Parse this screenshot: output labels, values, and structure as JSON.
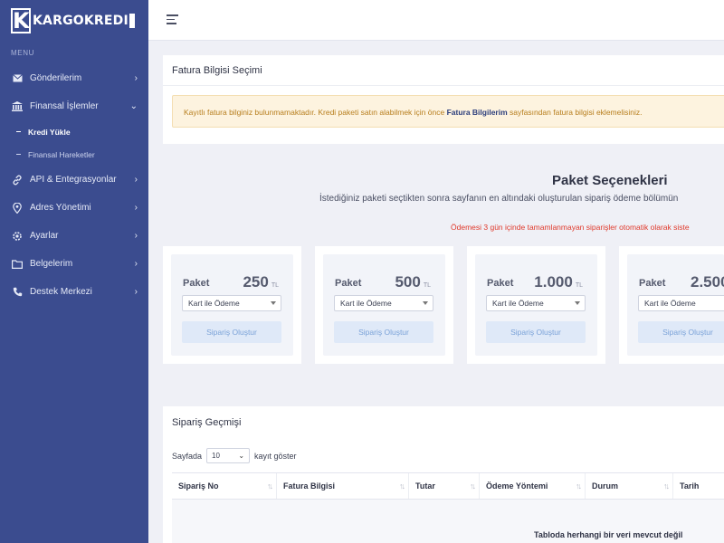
{
  "brand": {
    "name": "KARGOKREDI",
    "logo_letter": "K"
  },
  "sidebar": {
    "menu_heading": "MENU",
    "items": [
      {
        "label": "Gönderilerim",
        "icon": "envelope-icon",
        "expanded": false
      },
      {
        "label": "Finansal İşlemler",
        "icon": "bank-icon",
        "expanded": true,
        "children": [
          {
            "label": "Kredi Yükle",
            "active": true
          },
          {
            "label": "Finansal Hareketler",
            "active": false
          }
        ]
      },
      {
        "label": "API & Entegrasyonlar",
        "icon": "link-icon",
        "expanded": false
      },
      {
        "label": "Adres Yönetimi",
        "icon": "location-pin-icon",
        "expanded": false
      },
      {
        "label": "Ayarlar",
        "icon": "gear-icon",
        "expanded": false
      },
      {
        "label": "Belgelerim",
        "icon": "folder-icon",
        "expanded": false
      },
      {
        "label": "Destek Merkezi",
        "icon": "phone-icon",
        "expanded": false
      }
    ]
  },
  "fatura": {
    "title": "Fatura Bilgisi Seçimi",
    "alert_pre": "Kayıtlı fatura bilginiz bulunmamaktadır. Kredi paketi satın alabilmek için önce",
    "alert_link": "Fatura Bilgilerim",
    "alert_post": "sayfasından fatura bilgisi eklemelisiniz."
  },
  "paket": {
    "title": "Paket Seçenekleri",
    "subtitle": "İstediğiniz paketi seçtikten sonra sayfanın en altındaki oluşturulan sipariş ödeme bölümün",
    "warning": "Ödemesi 3 gün içinde tamamlanmayan siparişler otomatik olarak siste",
    "packages": [
      {
        "name": "Paket",
        "price": "250",
        "currency": "TL",
        "payment": "Kart ile Ödeme",
        "button": "Sipariş Oluştur"
      },
      {
        "name": "Paket",
        "price": "500",
        "currency": "TL",
        "payment": "Kart ile Ödeme",
        "button": "Sipariş Oluştur"
      },
      {
        "name": "Paket",
        "price": "1.000",
        "currency": "TL",
        "payment": "Kart ile Ödeme",
        "button": "Sipariş Oluştur"
      },
      {
        "name": "Paket",
        "price": "2.500",
        "currency": "",
        "payment": "Kart ile Ödeme",
        "button": "Sipariş Oluştur"
      }
    ]
  },
  "siparis": {
    "title": "Sipariş Geçmişi",
    "page_size_prefix": "Sayfada",
    "page_size_value": "10",
    "page_size_suffix": "kayıt göster",
    "columns": [
      "Sipariş No",
      "Fatura Bilgisi",
      "Tutar",
      "Ödeme Yöntemi",
      "Durum",
      "Tarih"
    ],
    "empty_text": "Tabloda herhangi bir veri mevcut değil"
  },
  "colors": {
    "sidebar": "#3b4c8f",
    "alert_bg": "#fdf3df",
    "alert_text": "#b77e1d",
    "warning": "#e0392b",
    "button_bg": "#dfe9f8"
  }
}
